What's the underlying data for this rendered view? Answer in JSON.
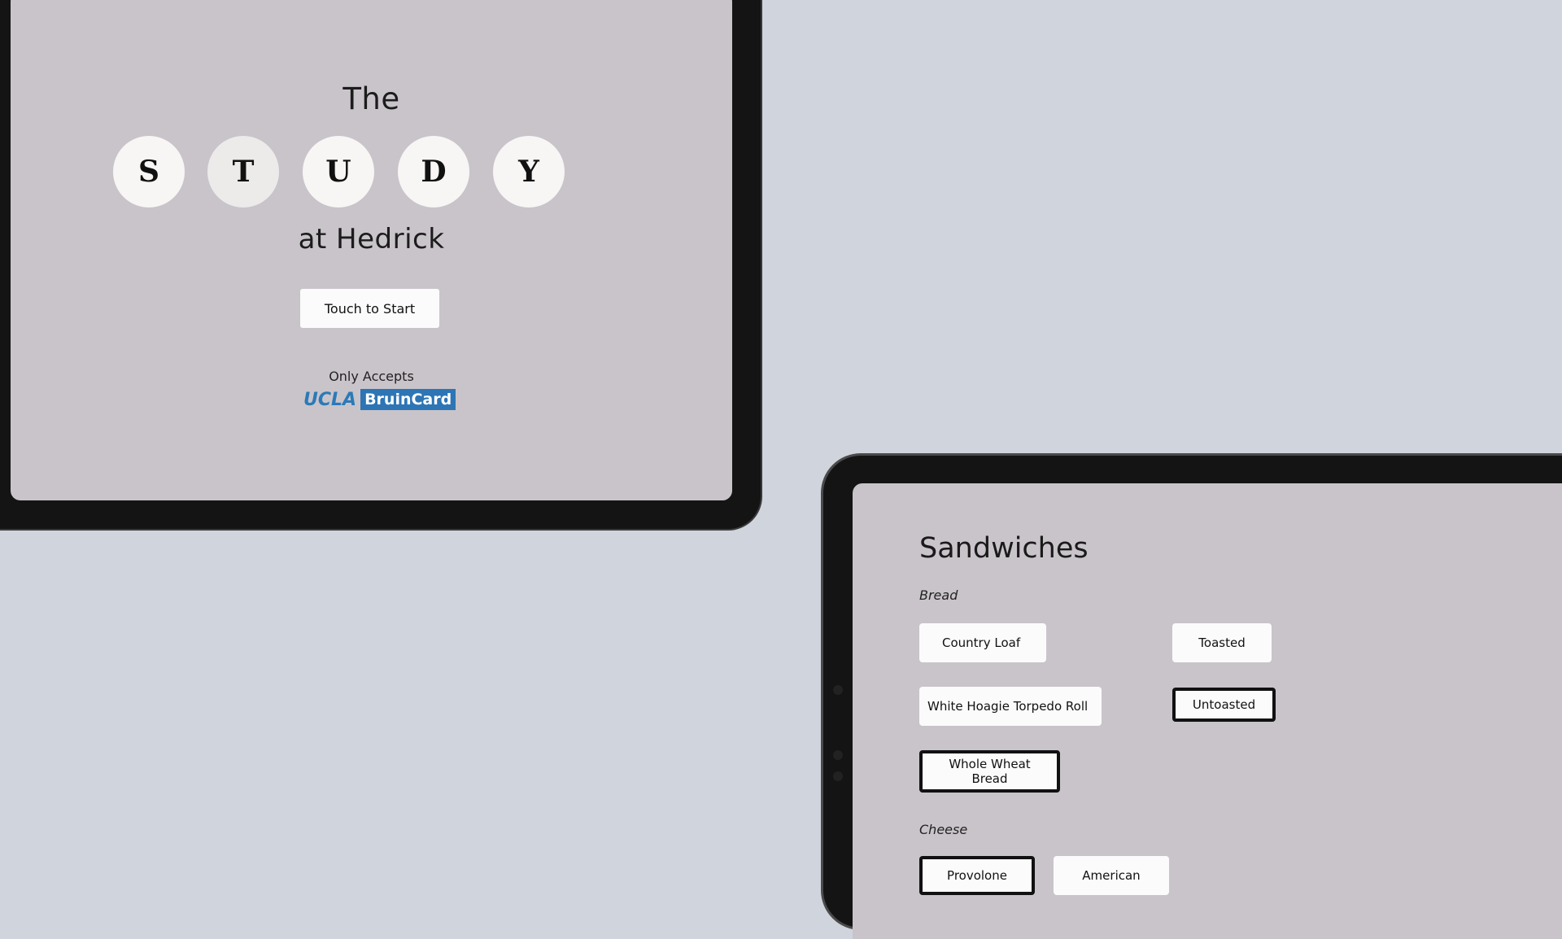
{
  "welcome": {
    "title_top": "The",
    "letters": [
      "S",
      "T",
      "U",
      "D",
      "Y"
    ],
    "title_bottom": "at Hedrick",
    "start_label": "Touch to Start",
    "accepts_label": "Only Accepts",
    "logo": {
      "ucla": "UCLA",
      "card": "BruinCard"
    }
  },
  "order": {
    "heading": "Sandwiches",
    "bread_label": "Bread",
    "bread_options": [
      "Country Loaf",
      "White Hoagie Torpedo Roll",
      "Whole Wheat Bread"
    ],
    "toast_options": [
      "Toasted",
      "Untoasted"
    ],
    "cheese_label": "Cheese",
    "cheese_options": [
      "Provolone",
      "American"
    ],
    "selected": {
      "bread": "Whole Wheat Bread",
      "toast": "Untoasted",
      "cheese": "Provolone"
    }
  },
  "colors": {
    "background": "#d0d4dc",
    "screen": "#c9c4ca",
    "bezel": "#141414",
    "brand_blue": "#2d75b5"
  }
}
